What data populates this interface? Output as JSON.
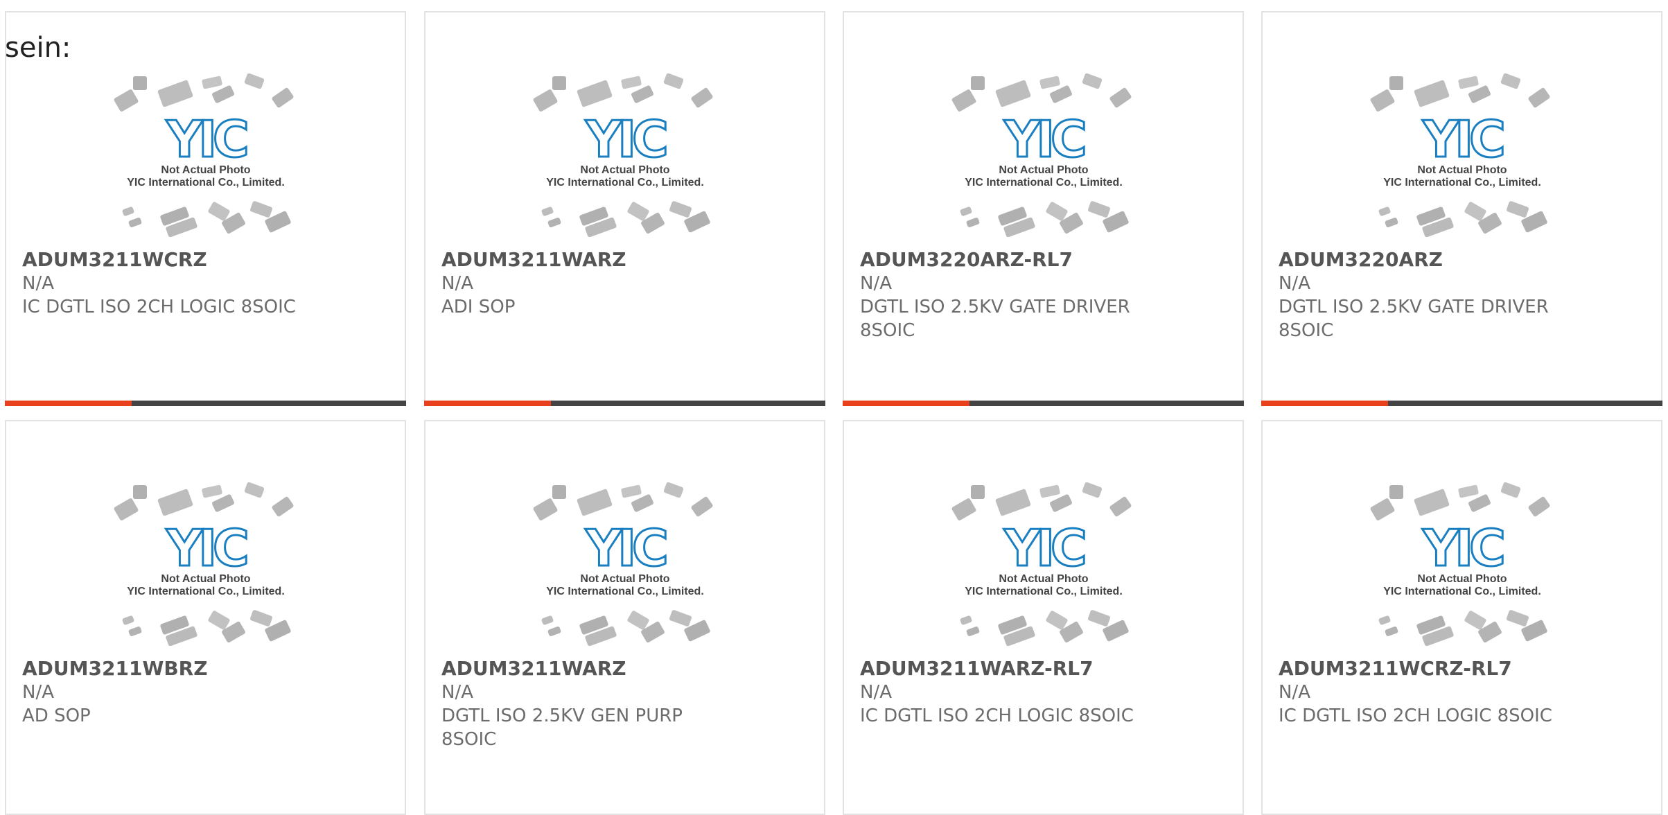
{
  "section_label": "sein:",
  "colors": {
    "accent": "#e8401c",
    "bar_dark": "#444444",
    "logo_blue": "#1a7fc1",
    "card_border": "#e2e2e2",
    "text_gray": "#6c6c6c"
  },
  "thumbnail": {
    "logo": "YIC",
    "caption_line1": "Not Actual Photo",
    "caption_line2": "YIC International Co., Limited."
  },
  "products": [
    {
      "part_number": "ADUM3211WCRZ",
      "manufacturer": "N/A",
      "description": "IC DGTL ISO 2CH LOGIC 8SOIC"
    },
    {
      "part_number": "ADUM3211WARZ",
      "manufacturer": "N/A",
      "description": "ADI SOP"
    },
    {
      "part_number": "ADUM3220ARZ-RL7",
      "manufacturer": "N/A",
      "description": "DGTL ISO 2.5KV GATE DRIVER 8SOIC"
    },
    {
      "part_number": "ADUM3220ARZ",
      "manufacturer": "N/A",
      "description": "DGTL ISO 2.5KV GATE DRIVER 8SOIC"
    },
    {
      "part_number": "ADUM3211WBRZ",
      "manufacturer": "N/A",
      "description": "AD SOP"
    },
    {
      "part_number": "ADUM3211WARZ",
      "manufacturer": "N/A",
      "description": "DGTL ISO 2.5KV GEN PURP 8SOIC"
    },
    {
      "part_number": "ADUM3211WARZ-RL7",
      "manufacturer": "N/A",
      "description": "IC DGTL ISO 2CH LOGIC 8SOIC"
    },
    {
      "part_number": "ADUM3211WCRZ-RL7",
      "manufacturer": "N/A",
      "description": "IC DGTL ISO 2CH LOGIC 8SOIC"
    }
  ]
}
